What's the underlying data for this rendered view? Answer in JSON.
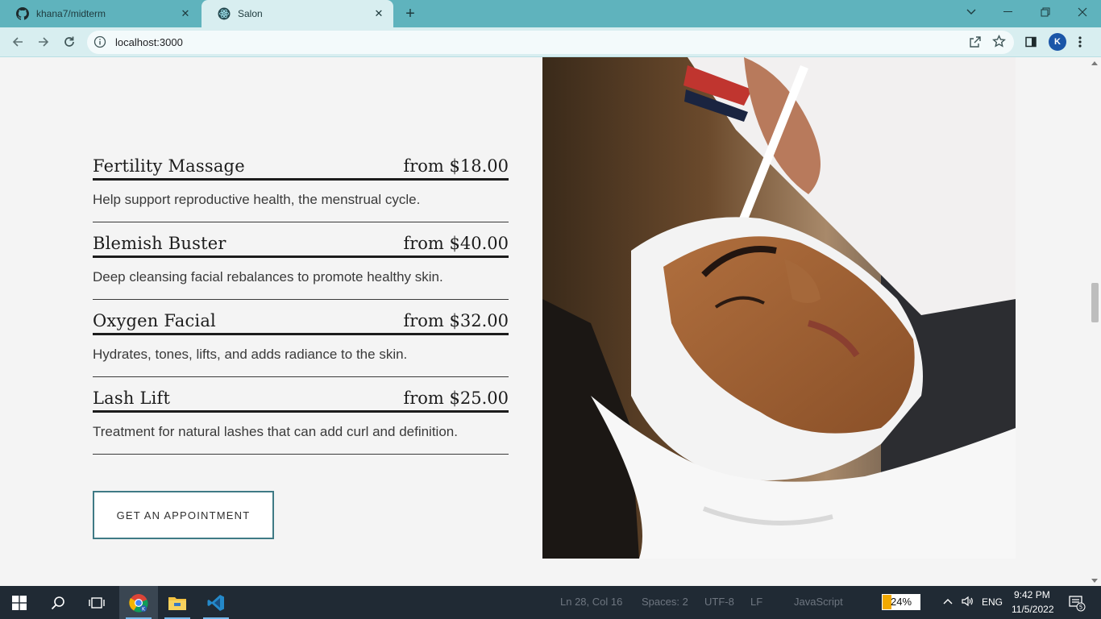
{
  "browser": {
    "tabs": [
      {
        "title": "khana7/midterm",
        "icon": "github-icon",
        "active": false
      },
      {
        "title": "Salon",
        "icon": "react-icon",
        "active": true
      }
    ],
    "url": "localhost:3000",
    "profile_initial": "K"
  },
  "page": {
    "services": [
      {
        "name": "Fertility Massage",
        "price": "from $18.00",
        "description": "Help support reproductive health, the menstrual cycle."
      },
      {
        "name": "Blemish Buster",
        "price": "from $40.00",
        "description": "Deep cleansing facial rebalances to promote healthy skin."
      },
      {
        "name": "Oxygen Facial",
        "price": "from $32.00",
        "description": "Hydrates, tones, lifts, and adds radiance to the skin."
      },
      {
        "name": "Lash Lift",
        "price": "from $25.00",
        "description": "Treatment for natural lashes that can add curl and definition."
      }
    ],
    "cta_label": "GET AN APPOINTMENT",
    "accent_color": "#3f7a85"
  },
  "taskbar": {
    "apps": [
      "windows-start-icon",
      "search-icon",
      "task-view-icon",
      "chrome-icon",
      "file-explorer-icon",
      "vscode-icon"
    ],
    "vscode_status": {
      "cursor": "Ln 28, Col 16",
      "spaces": "Spaces: 2",
      "encoding": "UTF-8",
      "eol": "LF",
      "language": "JavaScript"
    },
    "battery_percent": "24%",
    "battery_level": 0.24,
    "language": "ENG",
    "time": "9:42 PM",
    "date": "11/5/2022",
    "notification_count": "5"
  }
}
